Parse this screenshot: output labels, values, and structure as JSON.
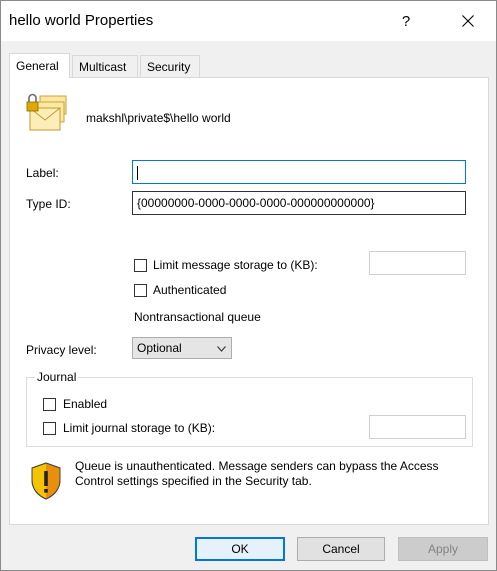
{
  "window": {
    "title": "hello world Properties",
    "help_label": "?"
  },
  "tabs": [
    {
      "label": "General"
    },
    {
      "label": "Multicast"
    },
    {
      "label": "Security"
    }
  ],
  "general": {
    "queue_path": "makshl\\private$\\hello world",
    "label_caption": "Label:",
    "label_value": "",
    "type_id_caption": "Type ID:",
    "type_id_value": "{00000000-0000-0000-0000-000000000000}",
    "limit_storage_label": "Limit message storage to (KB):",
    "limit_storage_value": "",
    "authenticated_label": "Authenticated",
    "queue_type": "Nontransactional queue",
    "privacy_caption": "Privacy level:",
    "privacy_value": "Optional",
    "journal": {
      "title": "Journal",
      "enabled_label": "Enabled",
      "limit_label": "Limit journal storage to (KB):",
      "limit_value": ""
    },
    "warning_text": "Queue is unauthenticated. Message senders can bypass the Access Control settings specified in the Security tab."
  },
  "buttons": {
    "ok": "OK",
    "cancel": "Cancel",
    "apply": "Apply"
  },
  "colors": {
    "focus_border": "#0078d7",
    "default_button_border": "#0078d7",
    "shield_yellow": "#f5c400",
    "shield_orange": "#e8900c"
  }
}
